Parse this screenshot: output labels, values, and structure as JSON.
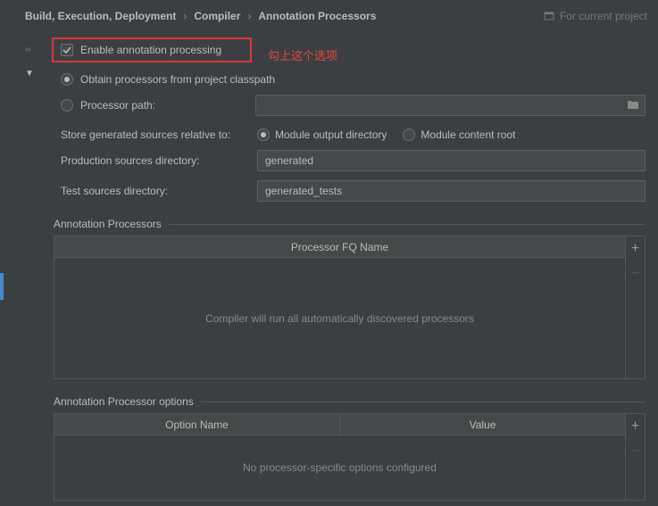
{
  "breadcrumb": {
    "items": [
      "Build, Execution, Deployment",
      "Compiler",
      "Annotation Processors"
    ],
    "project_scope": "For current project"
  },
  "annotation_text": "勾上这个选项",
  "enable": {
    "label": "Enable annotation processing",
    "checked": true
  },
  "source": {
    "classpath": "Obtain processors from project classpath",
    "path_label": "Processor path:",
    "path_value": ""
  },
  "store": {
    "label": "Store generated sources relative to:",
    "opt1": "Module output directory",
    "opt2": "Module content root"
  },
  "prod_dir": {
    "label": "Production sources directory:",
    "value": "generated"
  },
  "test_dir": {
    "label": "Test sources directory:",
    "value": "generated_tests"
  },
  "processors_section": {
    "title": "Annotation Processors",
    "col1": "Processor FQ Name",
    "empty": "Compiler will run all automatically discovered processors"
  },
  "options_section": {
    "title": "Annotation Processor options",
    "col1": "Option Name",
    "col2": "Value",
    "empty": "No processor-specific options configured"
  }
}
